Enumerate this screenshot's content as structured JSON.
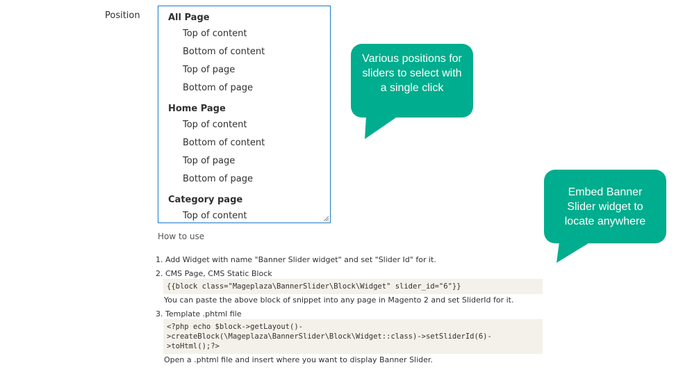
{
  "position": {
    "label": "Position",
    "groups": [
      {
        "label": "All Page",
        "options": [
          "Top of content",
          "Bottom of content",
          "Top of page",
          "Bottom of page"
        ]
      },
      {
        "label": "Home Page",
        "options": [
          "Top of content",
          "Bottom of content",
          "Top of page",
          "Bottom of page"
        ]
      },
      {
        "label": "Category page",
        "options": [
          "Top of content"
        ]
      }
    ]
  },
  "how_to_use": {
    "title": "How to use",
    "steps": [
      {
        "text": "1. Add Widget with name \"Banner Slider widget\" and set \"Slider Id\" for it."
      },
      {
        "text": "2. CMS Page, CMS Static Block",
        "code": "{{block class=\"Mageplaza\\BannerSlider\\Block\\Widget\" slider_id=\"6\"}}",
        "desc": "You can paste the above block of snippet into any page in Magento 2 and set SliderId for it."
      },
      {
        "text": "3. Template .phtml file",
        "code": "<?php echo $block->getLayout()-\n>createBlock(\\Mageplaza\\BannerSlider\\Block\\Widget::class)->setSliderId(6)-\n>toHtml();?>",
        "desc": "Open a .phtml file and insert where you want to display Banner Slider."
      }
    ]
  },
  "callouts": {
    "positions": "Various positions for sliders to select with a single click",
    "embed": "Embed Banner Slider widget to locate anywhere"
  },
  "colors": {
    "callout": "#00ad8e",
    "select_border": "#1979c3",
    "code_bg": "#f4f1ea"
  }
}
